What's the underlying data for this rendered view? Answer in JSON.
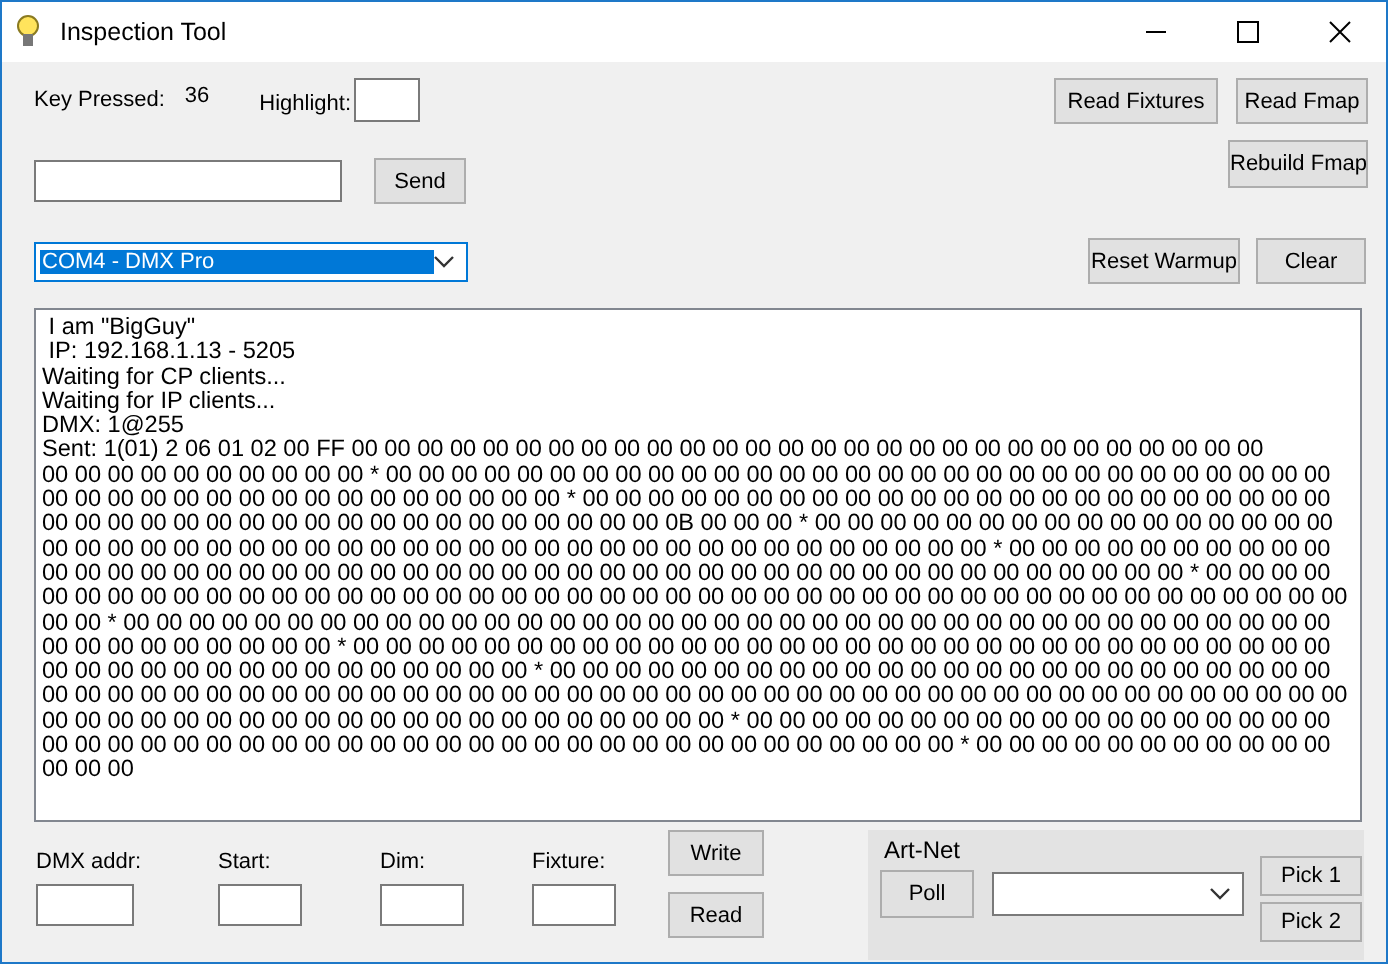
{
  "window": {
    "title": "Inspection Tool"
  },
  "key_pressed": {
    "label": "Key Pressed:",
    "value": "36"
  },
  "highlight": {
    "label": "Highlight:"
  },
  "send_button": "Send",
  "top_buttons": [
    "Read Fixtures",
    "Read Fmap"
  ],
  "rebuild_button": "Rebuild Fmap",
  "port_combo": {
    "value": "COM4 - DMX Pro",
    "text_selected": true
  },
  "combo_buttons": [
    "Reset Warmup",
    "Clear"
  ],
  "log": {
    "lines": [
      " I am \"BigGuy\"",
      " IP: 192.168.1.13 - 5205",
      "Waiting for CP clients...",
      "Waiting for IP clients...",
      "DMX: 1@255",
      "Sent: 1(01) 2 06 01 02 00 FF 00 00 00 00 00 00 00 00 00 00 00 00 00 00 00 00 00 00 00 00 00 00 00 00 00 00 00 00",
      "00 00 00 00 00 00 00 00 00 00 * 00 00 00 00 00 00 00 00 00 00 00 00 00 00 00 00 00 00 00 00 00 00 00 00 00 00 00 00 00",
      "00 00 00 00 00 00 00 00 00 00 00 00 00 00 00 00 * 00 00 00 00 00 00 00 00 00 00 00 00 00 00 00 00 00 00 00 00 00 00 00",
      "00 00 00 00 00 00 00 00 00 00 00 00 00 00 00 00 00 00 00 0B 00 00 00 * 00 00 00 00 00 00 00 00 00 00 00 00 00 00 00 00",
      "00 00 00 00 00 00 00 00 00 00 00 00 00 00 00 00 00 00 00 00 00 00 00 00 00 00 00 00 00 * 00 00 00 00 00 00 00 00 00 00",
      "00 00 00 00 00 00 00 00 00 00 00 00 00 00 00 00 00 00 00 00 00 00 00 00 00 00 00 00 00 00 00 00 00 00 00 * 00 00 00 00",
      "00 00 00 00 00 00 00 00 00 00 00 00 00 00 00 00 00 00 00 00 00 00 00 00 00 00 00 00 00 00 00 00 00 00 00 00 00 00 00 00",
      "00 00 * 00 00 00 00 00 00 00 00 00 00 00 00 00 00 00 00 00 00 00 00 00 00 00 00 00 00 00 00 00 00 00 00 00 00 00 00 00",
      "00 00 00 00 00 00 00 00 00 * 00 00 00 00 00 00 00 00 00 00 00 00 00 00 00 00 00 00 00 00 00 00 00 00 00 00 00 00 00 00",
      "00 00 00 00 00 00 00 00 00 00 00 00 00 00 00 * 00 00 00 00 00 00 00 00 00 00 00 00 00 00 00 00 00 00 00 00 00 00 00 00",
      "00 00 00 00 00 00 00 00 00 00 00 00 00 00 00 00 00 00 00 00 00 00 00 00 00 00 00 00 00 00 00 00 00 00 00 00 00 00 00 00",
      "00 00 00 00 00 00 00 00 00 00 00 00 00 00 00 00 00 00 00 00 00 * 00 00 00 00 00 00 00 00 00 00 00 00 00 00 00 00 00 00",
      "00 00 00 00 00 00 00 00 00 00 00 00 00 00 00 00 00 00 00 00 00 00 00 00 00 00 00 00 * 00 00 00 00 00 00 00 00 00 00 00",
      "00 00 00"
    ]
  },
  "fields": [
    {
      "label": "DMX addr:"
    },
    {
      "label": "Start:"
    },
    {
      "label": "Dim:"
    },
    {
      "label": "Fixture:"
    }
  ],
  "io_buttons": [
    "Write",
    "Read"
  ],
  "art_net": {
    "title": "Art-Net",
    "poll_button": "Poll",
    "pick_buttons": [
      "Pick 1",
      "Pick 2"
    ]
  }
}
